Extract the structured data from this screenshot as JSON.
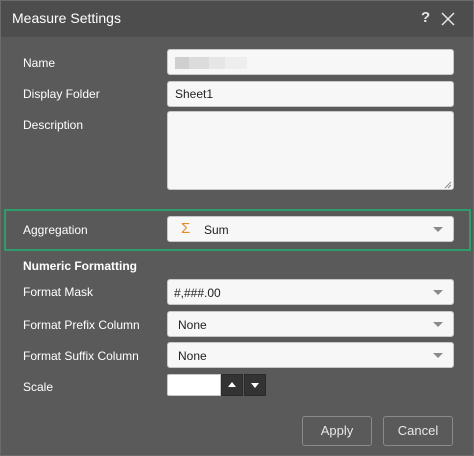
{
  "dialog": {
    "title": "Measure Settings",
    "help_glyph": "?"
  },
  "fields": {
    "name_label": "Name",
    "display_folder_label": "Display Folder",
    "display_folder_value": "Sheet1",
    "description_label": "Description",
    "description_value": ""
  },
  "aggregation": {
    "label": "Aggregation",
    "icon": "sigma-icon",
    "icon_glyph": "Σ",
    "value": "Sum",
    "highlight_color": "#2e9d6b"
  },
  "numeric_formatting": {
    "section_title": "Numeric Formatting",
    "format_mask_label": "Format Mask",
    "format_mask_value": "#,###.00",
    "prefix_label": "Format Prefix Column",
    "prefix_value": "None",
    "suffix_label": "Format Suffix Column",
    "suffix_value": "None",
    "scale_label": "Scale",
    "scale_value": ""
  },
  "footer": {
    "apply_label": "Apply",
    "cancel_label": "Cancel"
  }
}
